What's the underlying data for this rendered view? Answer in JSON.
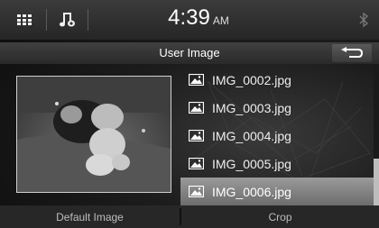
{
  "header": {
    "time": "4:39",
    "ampm": "AM"
  },
  "titlebar": {
    "title": "User Image"
  },
  "files": [
    "IMG_0002.jpg",
    "IMG_0003.jpg",
    "IMG_0004.jpg",
    "IMG_0005.jpg",
    "IMG_0006.jpg"
  ],
  "selected_file": "IMG_0006.jpg",
  "bottom": {
    "default_label": "Default Image",
    "crop_label": "Crop"
  },
  "icons": {
    "menu": "grid-icon",
    "audio": "music-source-icon",
    "bluetooth": "bluetooth-icon",
    "back": "back-arrow-icon",
    "file": "image-file-icon"
  },
  "colors": {
    "accent_selected": "#8a8a8a",
    "bar": "#2e2e2e"
  }
}
